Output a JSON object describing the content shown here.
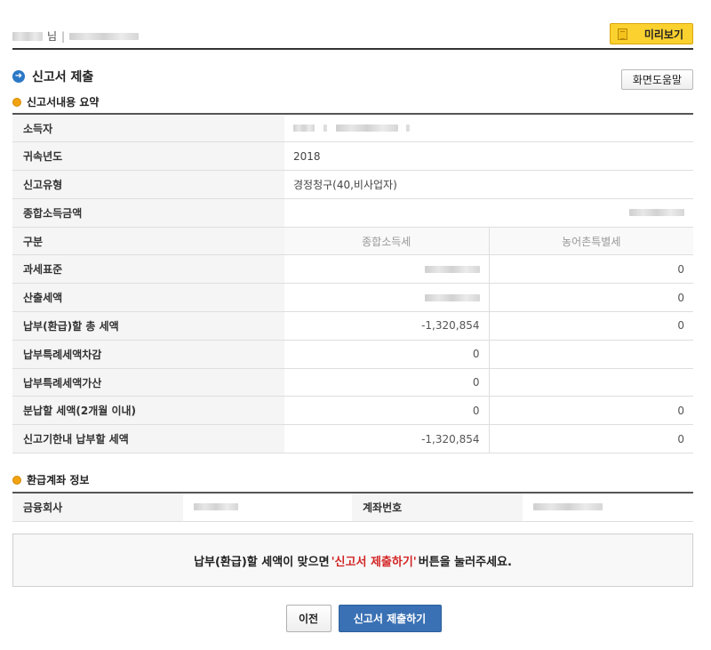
{
  "header": {
    "user_suffix": "님",
    "separator": "|",
    "preview_label": "미리보기",
    "preview_icon": "document-icon"
  },
  "page": {
    "title": "신고서 제출",
    "title_icon": "circle-arrow-icon",
    "help_label": "화면도움말"
  },
  "summary": {
    "title": "신고서내용 요약",
    "rows": {
      "income_person": "소득자",
      "year_label": "귀속년도",
      "year_value": "2018",
      "type_label": "신고유형",
      "type_value": "경정청구(40,비사업자)",
      "total_income_label": "종합소득금액",
      "category_label": "구분",
      "col_income_tax": "종합소득세",
      "col_rural_tax": "농어촌특별세",
      "tax_base_label": "과세표준",
      "tax_base_rural": "0",
      "calc_tax_label": "산출세액",
      "calc_tax_rural": "0",
      "total_due_label": "납부(환급)할 총 세액",
      "total_due_income": "-1,320,854",
      "total_due_rural": "0",
      "special_deduct_label": "납부특례세액차감",
      "special_deduct_income": "0",
      "special_add_label": "납부특례세액가산",
      "special_add_income": "0",
      "installment_label": "분납할 세액(2개월 이내)",
      "installment_income": "0",
      "installment_rural": "0",
      "deadline_label": "신고기한내 납부할 세액",
      "deadline_income": "-1,320,854",
      "deadline_rural": "0"
    }
  },
  "refund": {
    "title": "환급계좌 정보",
    "bank_label": "금융회사",
    "account_label": "계좌번호"
  },
  "notice": {
    "before": "납부(환급)할 세액이 맞으면",
    "highlight": "'신고서 제출하기'",
    "after": "버튼을 눌러주세요."
  },
  "buttons": {
    "prev_label": "이전",
    "submit_label": "신고서 제출하기"
  },
  "colors": {
    "accent_blue": "#3a71b4",
    "preview_yellow": "#fbd12f",
    "highlight_red": "#d32626"
  }
}
